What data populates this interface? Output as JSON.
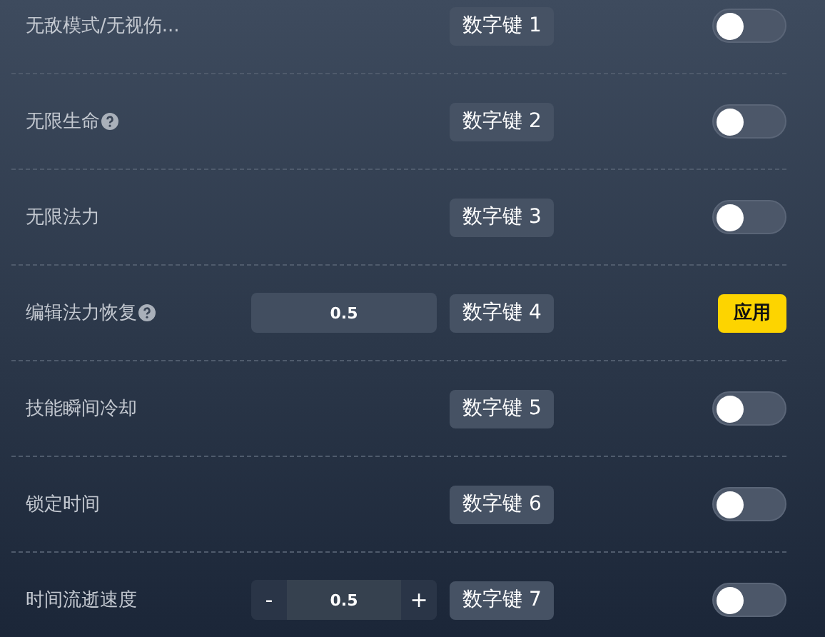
{
  "rows": [
    {
      "kind": "toggle",
      "label": "无敌模式/无视伤...",
      "help": false,
      "hotkey": "数字键 1",
      "on": false
    },
    {
      "kind": "toggle",
      "label": "无限生命",
      "help": true,
      "hotkey": "数字键 2",
      "on": false
    },
    {
      "kind": "toggle",
      "label": "无限法力",
      "help": false,
      "hotkey": "数字键 3",
      "on": false
    },
    {
      "kind": "apply",
      "label": "编辑法力恢复",
      "help": true,
      "value": "0.5",
      "hotkey": "数字键 4",
      "button": "应用"
    },
    {
      "kind": "toggle",
      "label": "技能瞬间冷却",
      "help": false,
      "hotkey": "数字键 5",
      "on": false
    },
    {
      "kind": "toggle",
      "label": "锁定时间",
      "help": false,
      "hotkey": "数字键 6",
      "on": false
    },
    {
      "kind": "stepper",
      "label": "时间流逝速度",
      "help": false,
      "value": "0.5",
      "minus": "-",
      "plus": "+",
      "hotkey": "数字键 7",
      "on": false
    }
  ]
}
